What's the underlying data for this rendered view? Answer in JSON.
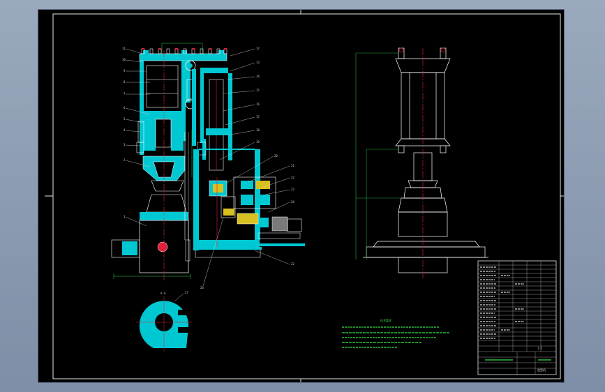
{
  "drawing": {
    "colors": {
      "sheet": "#000000",
      "frame": "#e8e8e8",
      "section_fill": "#00c8d2",
      "center_line": "#e0203a",
      "dimension": "#2fd04a",
      "leader": "#d8d8d8",
      "motor": "#7a7a7a",
      "gear": "#d8c020"
    },
    "part_numbers_left": [
      "11",
      "10",
      "9",
      "8",
      "7",
      "6",
      "5",
      "4",
      "3",
      "2",
      "1"
    ],
    "part_numbers_right": [
      "17",
      "13",
      "14",
      "15",
      "16",
      "17",
      "18",
      "19",
      "20",
      "21",
      "22",
      "23",
      "24",
      "25"
    ],
    "bottom_labels": [
      "26",
      "27",
      "22"
    ],
    "section_label": "A-A",
    "notes_title": "技术要求",
    "title_block": {
      "scale": "1:2",
      "name": "造型机"
    }
  }
}
